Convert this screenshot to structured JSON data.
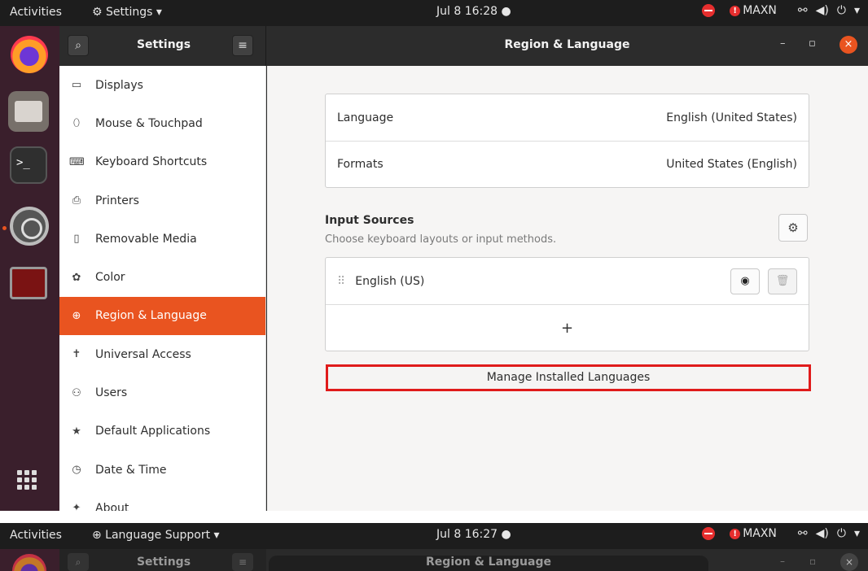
{
  "topbar": {
    "activities": "Activities",
    "app_menu": "Settings ▾",
    "clock": "Jul 8  16:28  ●",
    "power_profile": "MAXN"
  },
  "header": {
    "sidebar_title": "Settings",
    "window_title": "Region & Language",
    "search_icon": "⌕",
    "menu_icon": "≡",
    "minimize": "–",
    "maximize": "▫",
    "close": "×"
  },
  "sidebar": {
    "items": [
      {
        "label": "Displays",
        "icon": "▭"
      },
      {
        "label": "Mouse & Touchpad",
        "icon": "⬯"
      },
      {
        "label": "Keyboard Shortcuts",
        "icon": "⌨"
      },
      {
        "label": "Printers",
        "icon": "⎙"
      },
      {
        "label": "Removable Media",
        "icon": "▯"
      },
      {
        "label": "Color",
        "icon": "✿"
      },
      {
        "label": "Region & Language",
        "icon": "⊕"
      },
      {
        "label": "Universal Access",
        "icon": "✝"
      },
      {
        "label": "Users",
        "icon": "⚇"
      },
      {
        "label": "Default Applications",
        "icon": "★"
      },
      {
        "label": "Date & Time",
        "icon": "◷"
      },
      {
        "label": "About",
        "icon": "✦"
      }
    ]
  },
  "main": {
    "language": {
      "label": "Language",
      "value": "English (United States)"
    },
    "formats": {
      "label": "Formats",
      "value": "United States (English)"
    },
    "input_sources_title": "Input Sources",
    "input_sources_subtitle": "Choose keyboard layouts or input methods.",
    "input_source": "English (US)",
    "add_symbol": "+",
    "manage_button": "Manage Installed Languages"
  },
  "second_screenshot": {
    "activities": "Activities",
    "app_menu": "⊕ Language Support ▾",
    "clock": "Jul 8  16:27  ●",
    "power_profile": "MAXN",
    "sidebar_title": "Settings",
    "window_title": "Region & Language"
  },
  "colors": {
    "accent": "#e95420",
    "highlight_border": "#e01b1b",
    "headerbar": "#2c2c2c",
    "topbar": "#1d1d1d"
  }
}
